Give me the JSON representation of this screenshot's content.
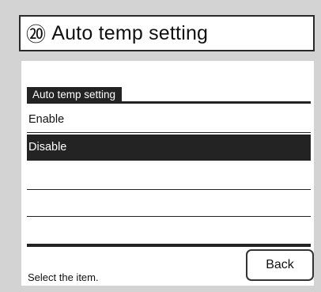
{
  "header": {
    "number": "⑳",
    "title": "Auto temp setting"
  },
  "setting": {
    "section_label": "Auto temp setting",
    "options": [
      {
        "label": "Enable",
        "selected": false
      },
      {
        "label": "Disable",
        "selected": true
      },
      {
        "label": "",
        "selected": false
      },
      {
        "label": "",
        "selected": false
      },
      {
        "label": "",
        "selected": false
      }
    ]
  },
  "footer": {
    "status": "Select the item.",
    "back_label": "Back"
  }
}
